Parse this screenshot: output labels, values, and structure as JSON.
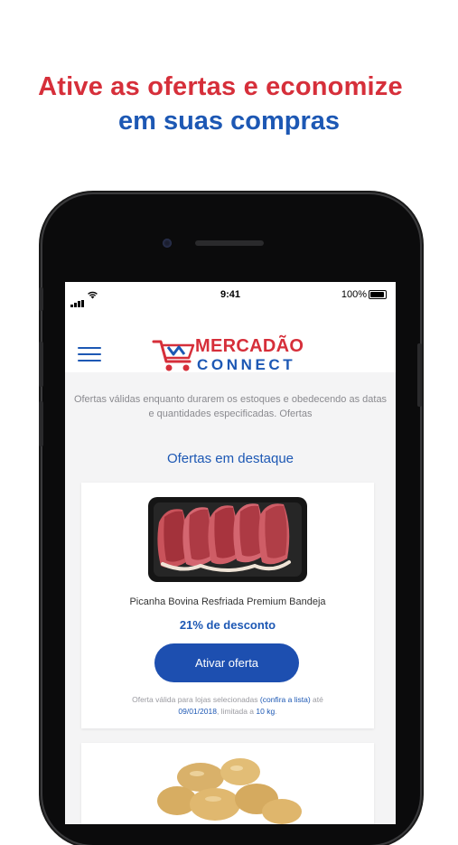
{
  "headline": {
    "line1": "Ative as ofertas e economize",
    "line2": "em suas compras"
  },
  "status_bar": {
    "time": "9:41",
    "battery": "100%"
  },
  "app": {
    "logo_line1": "MERCADÃO",
    "logo_line2": "CONNECT",
    "disclaimer": "Ofertas válidas enquanto durarem os estoques e obedecendo as datas e quantidades especificadas. Ofertas",
    "section_title": "Ofertas em destaque"
  },
  "offers": [
    {
      "title": "Picanha Bovina Resfriada Premium Bandeja",
      "discount": "21% de desconto",
      "button": "Ativar oferta",
      "validity_prefix": "Oferta válida para lojas selecionadas",
      "validity_link": "(confira a lista)",
      "validity_mid": "até",
      "validity_date": "09/01/2018",
      "validity_limit_prefix": ", limitada a",
      "validity_limit": "10 kg",
      "validity_end": "."
    }
  ],
  "colors": {
    "red": "#d62f3a",
    "blue": "#1d58b4",
    "button": "#1d4fb0"
  }
}
